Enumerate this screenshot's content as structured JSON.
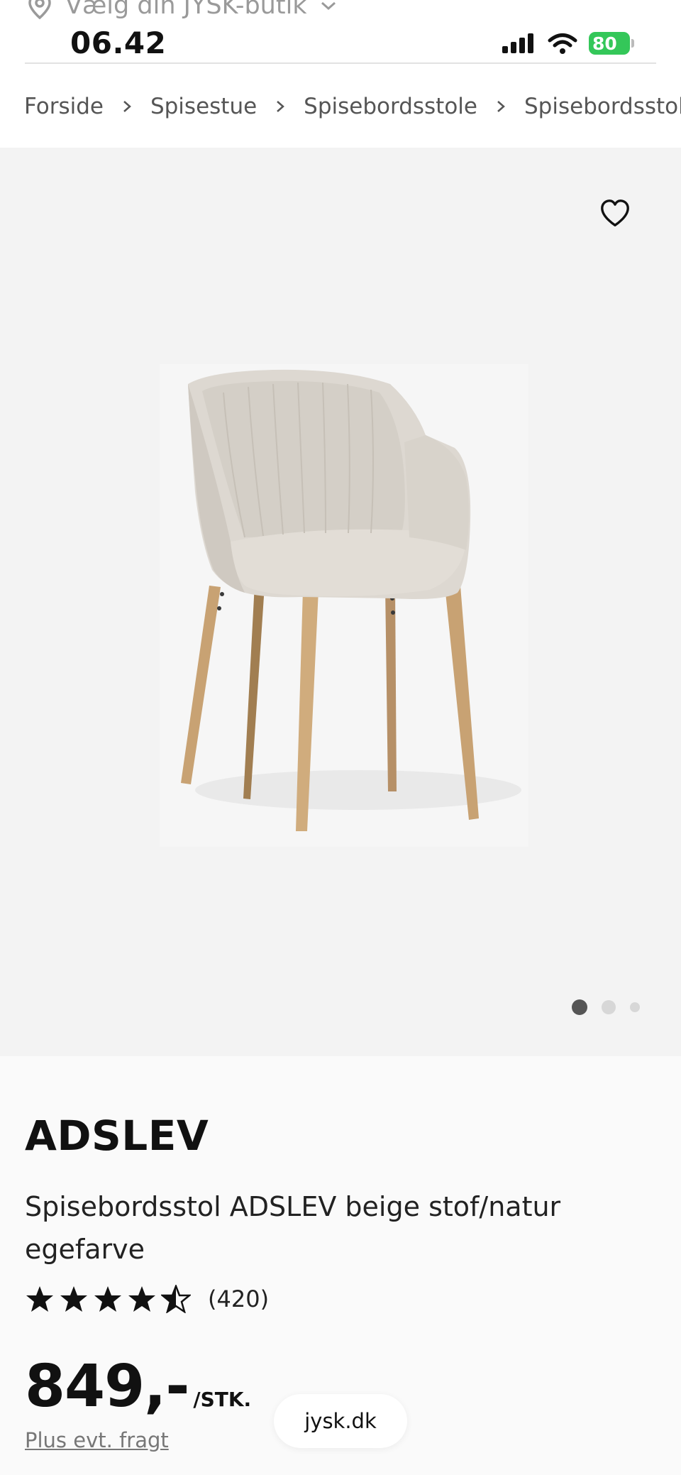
{
  "status_bar": {
    "store_prompt": "Vælg din JYSK-butik",
    "time": "06.42",
    "battery": "80"
  },
  "breadcrumb": [
    "Forside",
    "Spisestue",
    "Spisebordsstole",
    "Spisebordsstol ADSLEV"
  ],
  "gallery": {
    "image_count": 3,
    "active_index": 0
  },
  "product": {
    "brand": "ADSLEV",
    "description": "Spisebordsstol ADSLEV beige stof/natur egefarve",
    "rating": 4.5,
    "reviews": "(420)",
    "price": "849,-",
    "unit": "/STK.",
    "freight": "Plus evt. fragt"
  },
  "browser": {
    "url": "jysk.dk"
  },
  "colors": {
    "battery": "#34c759",
    "gallery_bg": "#f3f3f3",
    "fabric": "#ddd8d1",
    "oak": "#c8a273"
  }
}
